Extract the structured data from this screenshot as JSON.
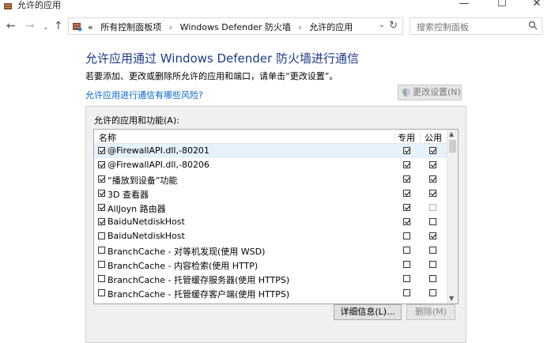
{
  "window": {
    "title": "允许的应用",
    "controls": {
      "minimize": "—",
      "maximize": "☐",
      "close": "✕"
    }
  },
  "address": {
    "crumbs": [
      "«",
      "所有控制面板项",
      "Windows Defender 防火墙",
      "允许的应用"
    ],
    "search_placeholder": "搜索控制面板"
  },
  "page": {
    "heading": "允许应用通过 Windows Defender 防火墙进行通信",
    "subtext": "若要添加、更改或删除所允许的应用和端口，请单击“更改设置”。",
    "risk_link": "允许应用进行通信有哪些风险?",
    "change_settings": "更改设置(N)"
  },
  "apps_group": {
    "label": "允许的应用和功能(A):",
    "columns": {
      "name": "名称",
      "private": "专用",
      "public": "公用"
    },
    "rows": [
      {
        "name": "@FirewallAPI.dll,-80201",
        "enabled": true,
        "private": true,
        "public": true
      },
      {
        "name": "@FirewallAPI.dll,-80206",
        "enabled": true,
        "private": true,
        "public": true
      },
      {
        "name": "“播放到设备”功能",
        "enabled": true,
        "private": true,
        "public": true
      },
      {
        "name": "3D 查看器",
        "enabled": true,
        "private": true,
        "public": true
      },
      {
        "name": "AllJoyn 路由器",
        "enabled": true,
        "private": true,
        "public": false
      },
      {
        "name": "BaiduNetdiskHost",
        "enabled": true,
        "private": true,
        "public": false
      },
      {
        "name": "BaiduNetdiskHost",
        "enabled": false,
        "private": false,
        "public": true
      },
      {
        "name": "BranchCache - 对等机发现(使用 WSD)",
        "enabled": false,
        "private": false,
        "public": false
      },
      {
        "name": "BranchCache - 内容检索(使用 HTTP)",
        "enabled": false,
        "private": false,
        "public": false
      },
      {
        "name": "BranchCache - 托管缓存服务器(使用 HTTPS)",
        "enabled": false,
        "private": false,
        "public": false
      },
      {
        "name": "BranchCache - 托管缓存客户端(使用 HTTPS)",
        "enabled": false,
        "private": false,
        "public": false
      }
    ],
    "details_button": "详细信息(L)...",
    "delete_button": "删除(M)"
  }
}
